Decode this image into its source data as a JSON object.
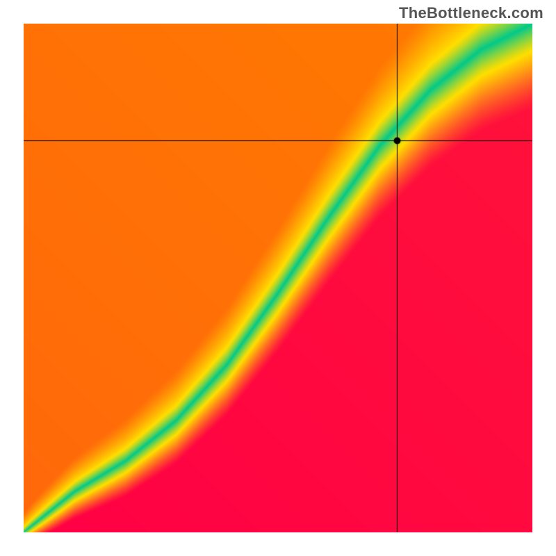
{
  "watermark": "TheBottleneck.com",
  "chart_data": {
    "type": "heatmap",
    "title": "",
    "xlabel": "",
    "ylabel": "",
    "xlim": [
      0,
      1
    ],
    "ylim": [
      0,
      1
    ],
    "crosshair": {
      "x": 0.735,
      "y": 0.77
    },
    "marker": {
      "x": 0.735,
      "y": 0.77,
      "radius_px": 5
    },
    "ridge_control_points": [
      {
        "x": 0.0,
        "y": 0.0
      },
      {
        "x": 0.1,
        "y": 0.08
      },
      {
        "x": 0.2,
        "y": 0.14
      },
      {
        "x": 0.3,
        "y": 0.22
      },
      {
        "x": 0.4,
        "y": 0.33
      },
      {
        "x": 0.5,
        "y": 0.47
      },
      {
        "x": 0.6,
        "y": 0.62
      },
      {
        "x": 0.7,
        "y": 0.76
      },
      {
        "x": 0.8,
        "y": 0.87
      },
      {
        "x": 0.9,
        "y": 0.95
      },
      {
        "x": 1.0,
        "y": 1.0
      }
    ],
    "ridge_width_norm": 0.055,
    "ridge_width_min_norm": 0.008,
    "colors": {
      "bottom_left": "#ff0044",
      "top_right": "#ff7a00",
      "mid": "#ffde00",
      "ridge": "#00c98a",
      "crosshair": "#000000",
      "marker": "#000000"
    }
  }
}
